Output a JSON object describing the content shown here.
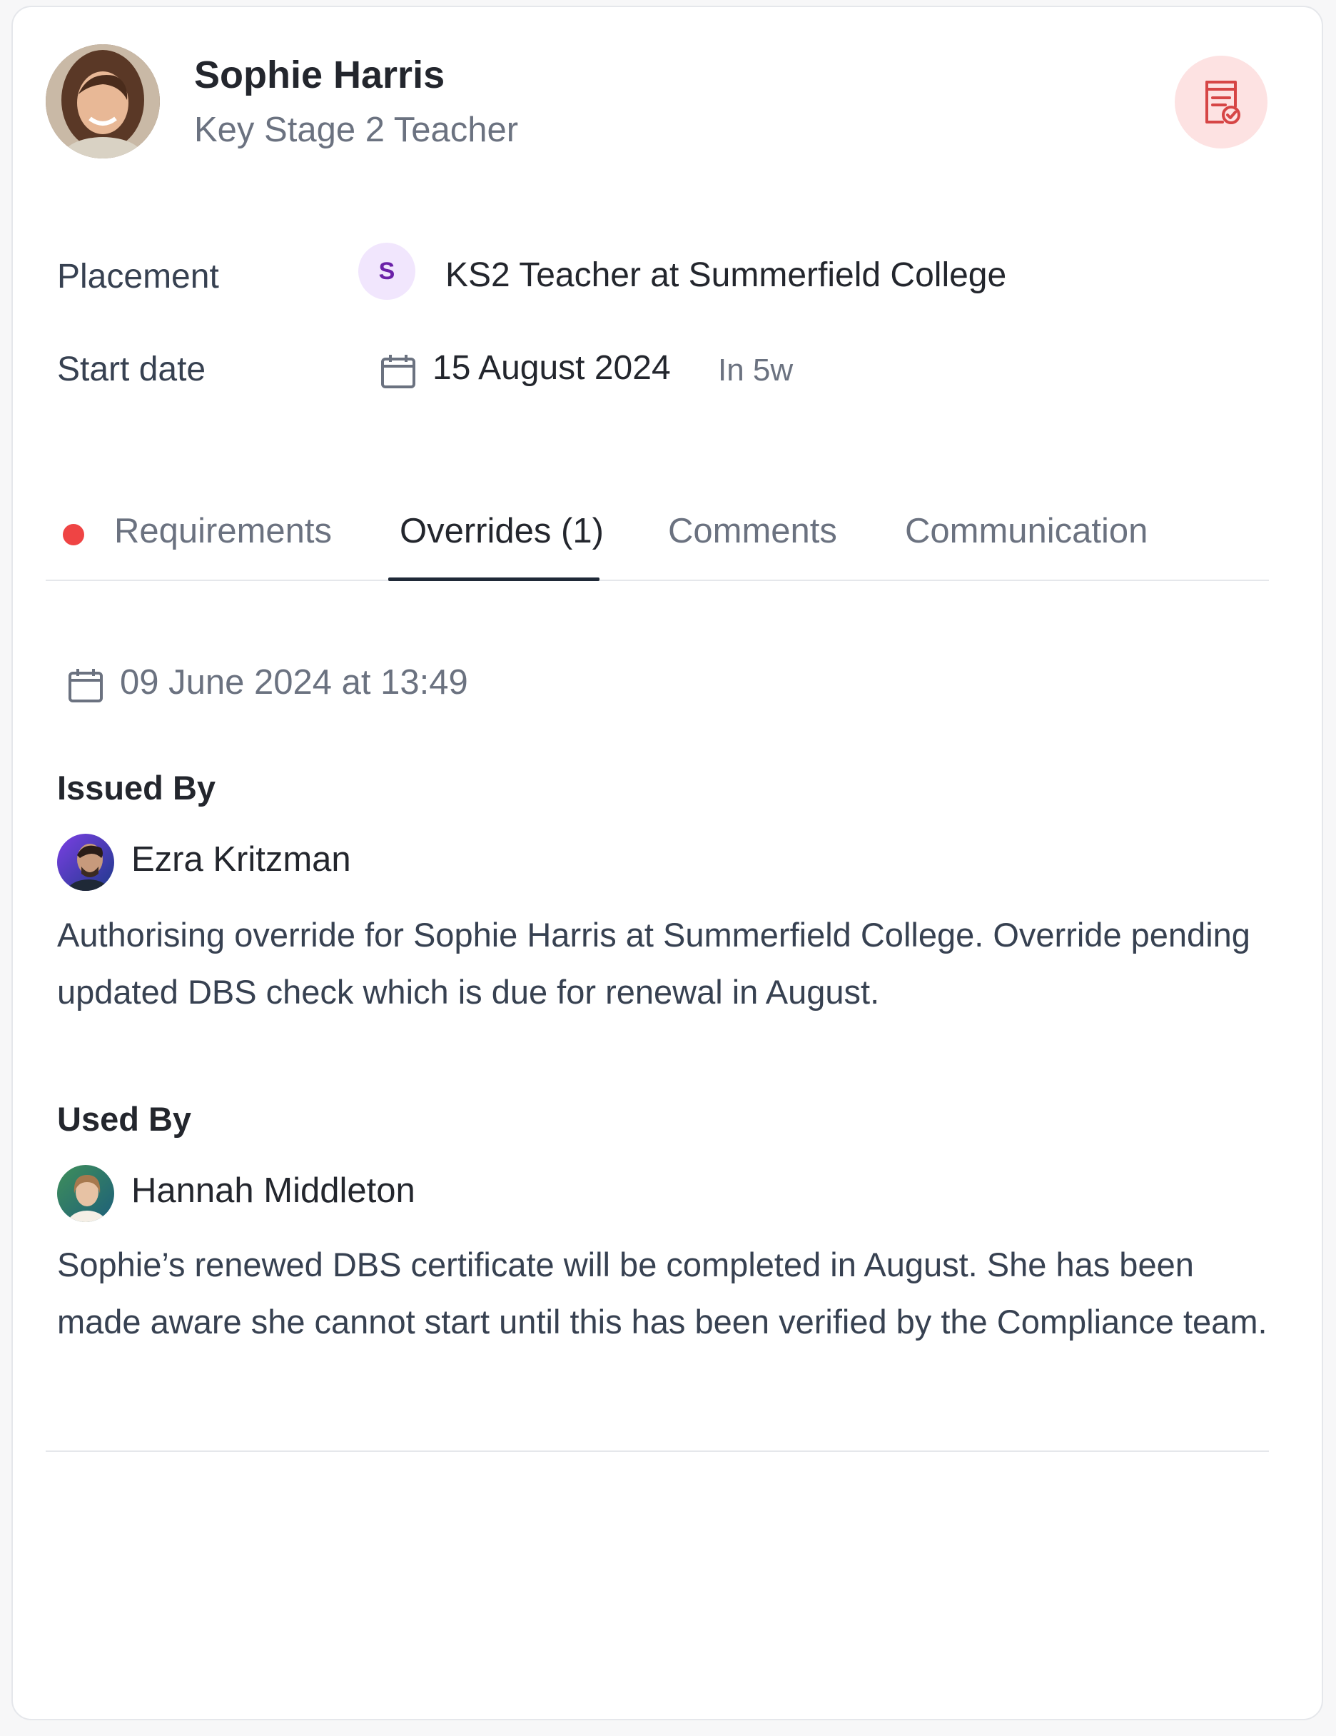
{
  "profile": {
    "name": "Sophie Harris",
    "role": "Key Stage 2 Teacher"
  },
  "details": {
    "placement_label": "Placement",
    "placement_badge": "S",
    "placement_value": "KS2 Teacher at Summerfield College",
    "start_label": "Start date",
    "start_value": "15 August 2024",
    "start_relative": "In 5w"
  },
  "tabs": [
    {
      "label": "Requirements",
      "has_alert_dot": true
    },
    {
      "label": "Overrides (1)",
      "active": true
    },
    {
      "label": "Comments"
    },
    {
      "label": "Communication"
    }
  ],
  "override": {
    "timestamp": "09 June 2024 at 13:49",
    "issued_by_heading": "Issued By",
    "issued_by_name": "Ezra Kritzman",
    "issued_by_note": "Authorising override for Sophie Harris at Summerfield College. Override pending updated DBS check which is due for renewal in August.",
    "used_by_heading": "Used By",
    "used_by_name": "Hannah Middleton",
    "used_by_note": "Sophie’s renewed DBS certificate will be completed in August. She has been made aware she cannot start until this has been verified by the Compliance team."
  },
  "icons": {
    "header_action": "certificate-check-icon",
    "date": "calendar-icon"
  },
  "colors": {
    "accent_red": "#ef4444",
    "badge_purple": "#6b21a8",
    "tab_active": "#1f2937"
  }
}
